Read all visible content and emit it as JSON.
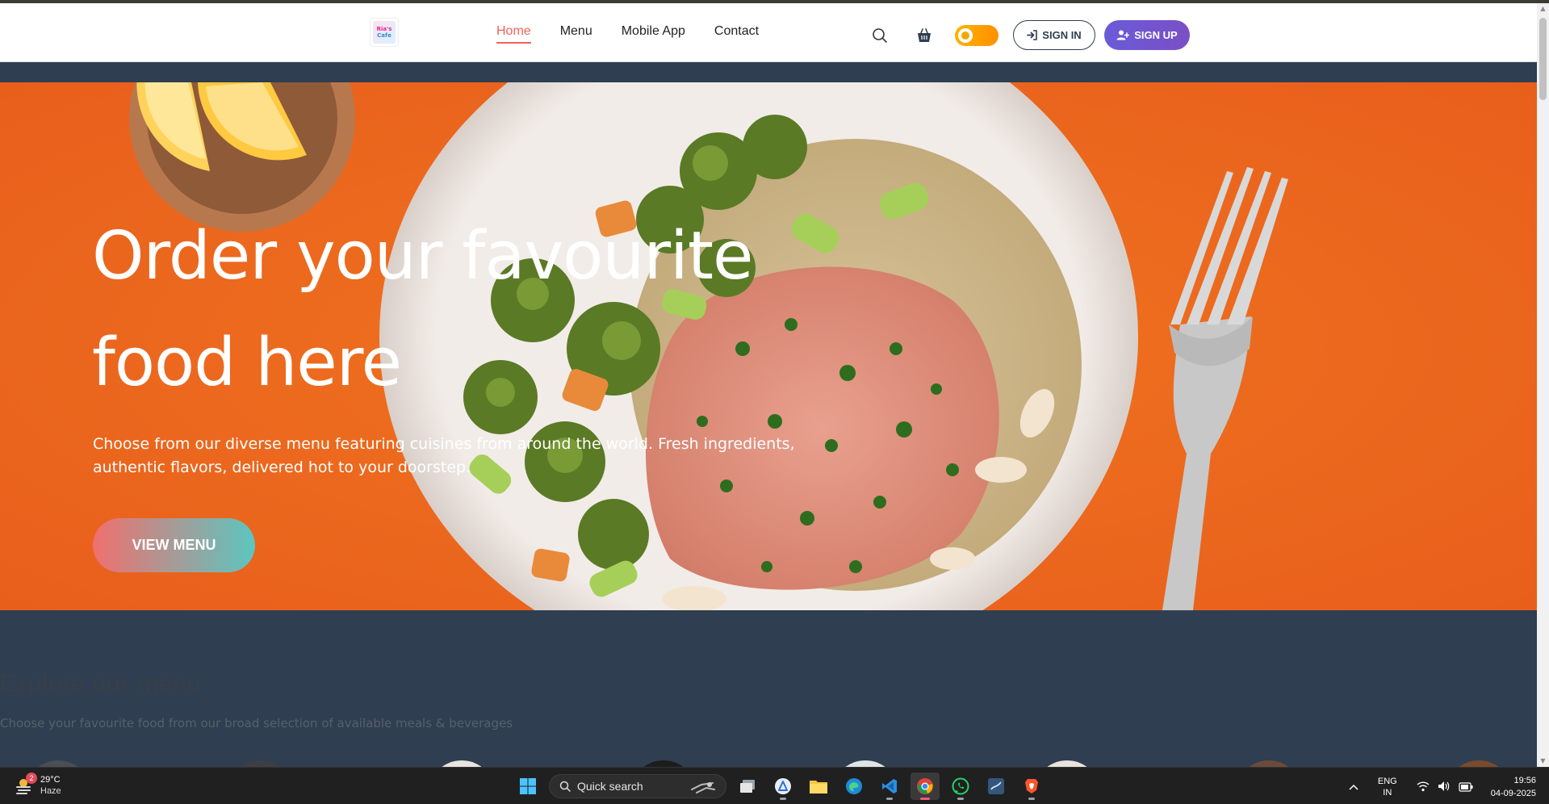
{
  "navbar": {
    "logo_line1": "Ria's",
    "logo_line2": "Cafe",
    "links": [
      "Home",
      "Menu",
      "Mobile App",
      "Contact"
    ],
    "active_link": "Home",
    "signin_label": "SIGN IN",
    "signup_label": "SIGN UP"
  },
  "hero": {
    "title_line1": "Order your favourite",
    "title_line2": "food here",
    "subtitle_line1": "Choose from our diverse menu featuring cuisines from around the world. Fresh ingredients,",
    "subtitle_line2": "authentic flavors, delivered hot to your doorstep.",
    "cta_label": "VIEW MENU"
  },
  "explore": {
    "title": "Explore our menu",
    "subtitle": "Choose your favourite food from our broad selection of available meals & beverages"
  },
  "taskbar": {
    "weather_temp": "29°C",
    "weather_condition": "Haze",
    "weather_badge": "2",
    "search_placeholder": "Quick search",
    "language_line1": "ENG",
    "language_line2": "IN",
    "time": "19:56",
    "date": "04-09-2025"
  },
  "colors": {
    "accent": "#f0625a",
    "dark": "#2f3e50",
    "signup": "#6a5bd8",
    "hero_bg": "#f06a22"
  }
}
